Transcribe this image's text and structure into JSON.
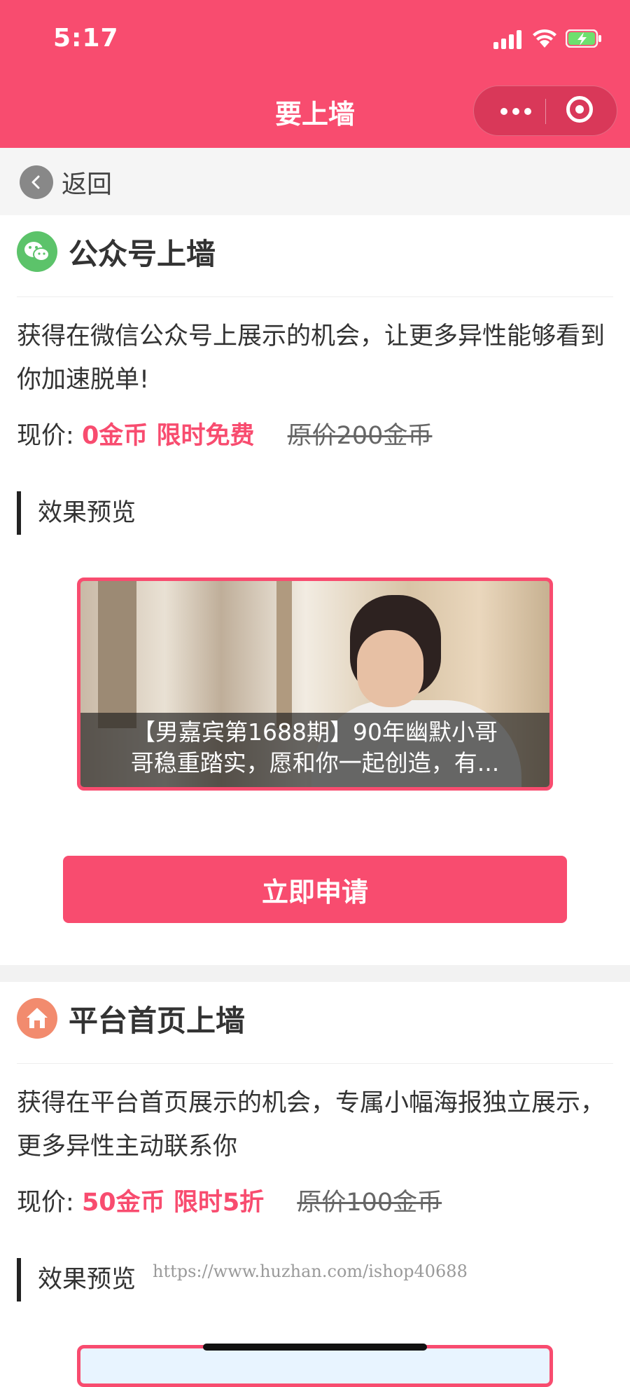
{
  "status_bar": {
    "time": "5:17"
  },
  "nav": {
    "title": "要上墙"
  },
  "back": {
    "label": "返回"
  },
  "card1": {
    "title": "公众号上墙",
    "description": "获得在微信公众号上展示的机会，让更多异性能够看到你加速脱单!",
    "price_label": "现价:",
    "price_now": "0金币 限时免费",
    "price_original": "原价200金币",
    "preview_label": "效果预览",
    "preview_caption_line1": "【男嘉宾第1688期】90年幽默小哥",
    "preview_caption_line2": "哥稳重踏实，愿和你一起创造，有...",
    "apply_button": "立即申请"
  },
  "card2": {
    "title": "平台首页上墙",
    "description": "获得在平台首页展示的机会，专属小幅海报独立展示，更多异性主动联系你",
    "price_label": "现价:",
    "price_now": "50金币 限时5折",
    "price_original": "原价100金币",
    "preview_label": "效果预览"
  },
  "watermark": "https://www.huzhan.com/ishop40688",
  "colors": {
    "brand": "#f84c6f",
    "wechat_green": "#5cc36a",
    "home_orange": "#f28b6e"
  }
}
